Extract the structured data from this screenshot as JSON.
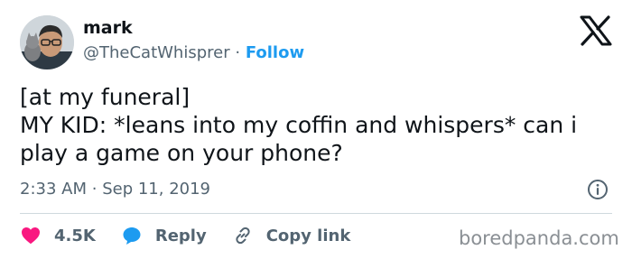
{
  "user": {
    "name": "mark",
    "handle": "@TheCatWhisprer",
    "separator": "·",
    "follow_label": "Follow"
  },
  "tweet": {
    "lines": [
      "[at my funeral]",
      "MY KID: *leans into my coffin and whispers* can i",
      "play a game on your phone?"
    ],
    "time": "2:33 AM",
    "date_separator": "·",
    "date": "Sep 11, 2019"
  },
  "actions": {
    "likes": "4.5K",
    "reply_label": "Reply",
    "copy_label": "Copy link"
  },
  "icons": {
    "brand": "x-logo-icon",
    "info": "info-icon",
    "like": "heart-icon",
    "reply": "speech-bubble-icon",
    "copy": "link-icon"
  },
  "colors": {
    "follow": "#1d9bf0",
    "heart": "#f91880",
    "reply_bubble": "#1d9bf0",
    "secondary_text": "#536471"
  },
  "watermark": "boredpanda.com"
}
